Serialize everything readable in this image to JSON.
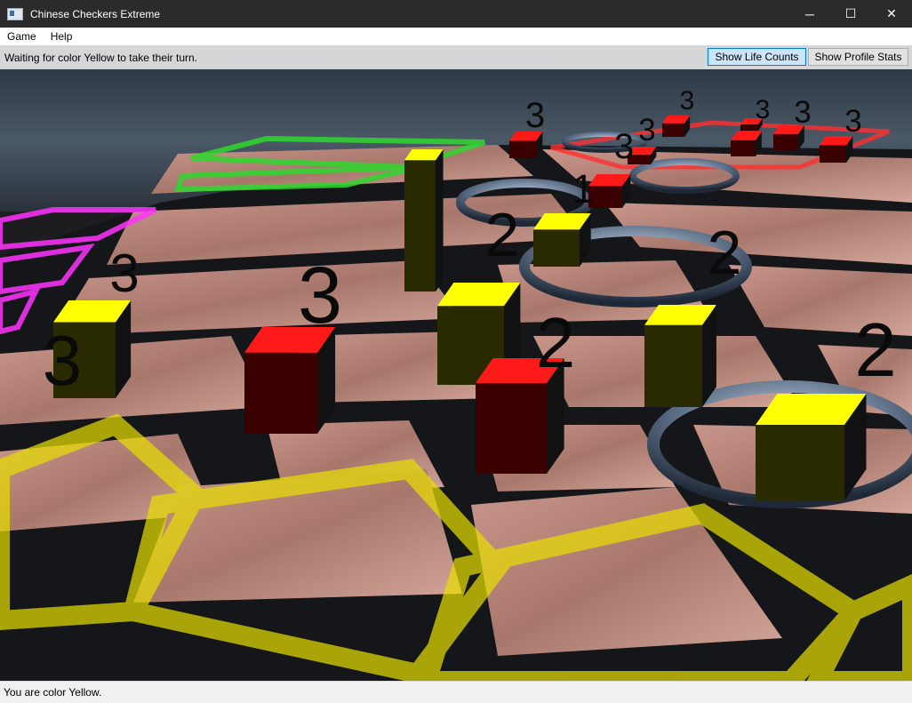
{
  "window": {
    "title": "Chinese Checkers Extreme",
    "icon": "app-window-icon"
  },
  "window_controls": {
    "minimize": "─",
    "maximize": "☐",
    "close": "✕"
  },
  "menu": {
    "items": [
      "Game",
      "Help"
    ]
  },
  "toolbar": {
    "status": "Waiting for color Yellow to take their turn.",
    "life_counts_label": "Show Life Counts",
    "life_counts_active": true,
    "profile_stats_label": "Show Profile Stats"
  },
  "board": {
    "colors": {
      "yellow": "#ffff00",
      "red": "#ff0000",
      "green": "#00ff00",
      "magenta": "#ff00ff",
      "ring": "#5a7090"
    },
    "pieces": [
      {
        "color": "yellow",
        "life": "3"
      },
      {
        "color": "yellow",
        "life": "3"
      },
      {
        "color": "red",
        "life": "3"
      },
      {
        "color": "yellow",
        "life": "2"
      },
      {
        "color": "red",
        "life": "2"
      },
      {
        "color": "yellow",
        "life": "2"
      },
      {
        "color": "yellow",
        "life": "2"
      },
      {
        "color": "yellow",
        "life": "2"
      },
      {
        "color": "red",
        "life": "1"
      },
      {
        "color": "red",
        "life": "3"
      },
      {
        "color": "red",
        "life": "3"
      },
      {
        "color": "red",
        "life": "3"
      },
      {
        "color": "red",
        "life": "3"
      },
      {
        "color": "red",
        "life": "3"
      },
      {
        "color": "red",
        "life": "3"
      },
      {
        "color": "red",
        "life": "3"
      }
    ]
  },
  "statusbar": {
    "text": "You are color Yellow."
  }
}
